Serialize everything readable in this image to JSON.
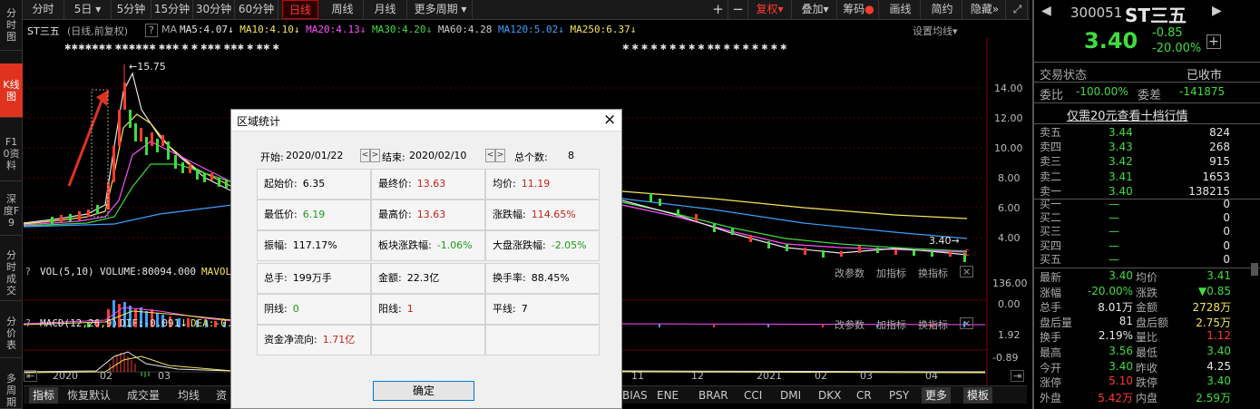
{
  "left_tabs": [
    {
      "label": "分时图",
      "active": false
    },
    {
      "label": "K线图",
      "active": true
    },
    {
      "label": "F10资料",
      "active": false
    },
    {
      "label": "深度F9",
      "active": false
    },
    {
      "label": "分时成交",
      "active": false
    },
    {
      "label": "分价表",
      "active": false
    },
    {
      "label": "多周期",
      "active": false
    }
  ],
  "toolbar": {
    "periods": [
      "分时",
      "5日",
      "5分钟",
      "15分钟",
      "30分钟",
      "60分钟",
      "日线",
      "周线",
      "月线",
      "更多周期"
    ],
    "active_period": "日线",
    "plus": "+",
    "minus": "−",
    "fuquan": "复权",
    "diejia": "叠加",
    "chouma": "筹码",
    "huaxian": "画线",
    "jianyue": "简约",
    "yincang": "隐藏"
  },
  "chart_header": {
    "name": "ST三五",
    "mode": "(日线,前复权)",
    "help": "?",
    "ma_label": "MA",
    "ma": [
      {
        "text": "MA5:4.07",
        "color": "#e6e6e6"
      },
      {
        "text": "MA10:4.10",
        "color": "#f5e55a"
      },
      {
        "text": "MA20:4.13",
        "color": "#ff4fff"
      },
      {
        "text": "MA30:4.20",
        "color": "#3fdc3f"
      },
      {
        "text": "MA60:4.28",
        "color": "#cccccc"
      },
      {
        "text": "MA120:5.02",
        "color": "#3aa0ff"
      },
      {
        "text": "MA250:6.37",
        "color": "#f5e55a"
      }
    ],
    "settings": "设置均线"
  },
  "price_axis": [
    "14.00",
    "12.00",
    "10.00",
    "8.00",
    "6.00",
    "4.00"
  ],
  "annotations": {
    "high": "15.75",
    "last": "3.40",
    "c_mark": "C"
  },
  "volume_panel": {
    "title": "VOL(5,10)",
    "value": "VOLUME:80094.000",
    "mavol": "MAVOL",
    "axis": [
      "136.00",
      "0.00"
    ],
    "actions": [
      "改参数",
      "加指标",
      "换指标"
    ]
  },
  "macd_panel": {
    "title": "MACD(12,26,9)",
    "dif": "DIF:-0.091",
    "dea": "DEA:-0.",
    "axis": [
      "1.92",
      "-0.89"
    ],
    "actions": [
      "改参数",
      "加指标",
      "换指标"
    ]
  },
  "time_axis": [
    "2020",
    "02",
    "03",
    "11",
    "12",
    "2021",
    "02",
    "03",
    "04"
  ],
  "bottom_bar": {
    "tabs_left": [
      "指标",
      "恢复默认",
      "成交量",
      "均线",
      "资"
    ],
    "tabs_right": [
      "BIAS",
      "ENE",
      "BRAR",
      "CCI",
      "DMI",
      "DKX",
      "CR",
      "PSY",
      "更多",
      "模板"
    ]
  },
  "right_panel": {
    "code": "300051",
    "name": "ST三五",
    "price": "3.40",
    "change": "-0.85",
    "change_pct": "-20.00%",
    "status_label": "交易状态",
    "status_value": "已收市",
    "weibi_label": "委比",
    "weibi": "-100.00%",
    "weicha_label": "委差",
    "weicha": "-141875",
    "promo": "仅需20元查看十档行情",
    "asks": [
      {
        "label": "卖五",
        "price": "3.44",
        "vol": "824"
      },
      {
        "label": "卖四",
        "price": "3.43",
        "vol": "268"
      },
      {
        "label": "卖三",
        "price": "3.42",
        "vol": "915"
      },
      {
        "label": "卖二",
        "price": "3.41",
        "vol": "1653"
      },
      {
        "label": "卖一",
        "price": "3.40",
        "vol": "138215"
      }
    ],
    "bids": [
      {
        "label": "买一",
        "price": "—",
        "vol": "0"
      },
      {
        "label": "买二",
        "price": "—",
        "vol": "0"
      },
      {
        "label": "买三",
        "price": "—",
        "vol": "0"
      },
      {
        "label": "买四",
        "price": "—",
        "vol": "0"
      },
      {
        "label": "买五",
        "price": "—",
        "vol": "0"
      }
    ],
    "stats": [
      {
        "l1": "最新",
        "v1": "3.40",
        "c1": "#3fdc3f",
        "l2": "均价",
        "v2": "3.41",
        "c2": "#3fdc3f"
      },
      {
        "l1": "涨幅",
        "v1": "-20.00%",
        "c1": "#3fdc3f",
        "l2": "涨跌",
        "v2": "▼0.85",
        "c2": "#3fdc3f"
      },
      {
        "l1": "总手",
        "v1": "8.01万",
        "c1": "#e6e6e6",
        "l2": "金额",
        "v2": "2728万",
        "c2": "#f5e55a"
      },
      {
        "l1": "盘后量",
        "v1": "81",
        "c1": "#e6e6e6",
        "l2": "盘后额",
        "v2": "2.75万",
        "c2": "#f5e55a"
      },
      {
        "l1": "换手",
        "v1": "2.19%",
        "c1": "#e6e6e6",
        "l2": "量比",
        "v2": "1.12",
        "c2": "#ff3b2f"
      },
      {
        "l1": "最高",
        "v1": "3.56",
        "c1": "#3fdc3f",
        "l2": "最低",
        "v2": "3.40",
        "c2": "#3fdc3f"
      },
      {
        "l1": "今开",
        "v1": "3.40",
        "c1": "#3fdc3f",
        "l2": "昨收",
        "v2": "4.25",
        "c2": "#e6e6e6"
      },
      {
        "l1": "涨停",
        "v1": "5.10",
        "c1": "#ff3b2f",
        "l2": "跌停",
        "v2": "3.40",
        "c2": "#3fdc3f"
      },
      {
        "l1": "外盘",
        "v1": "5.42万",
        "c1": "#ff3b2f",
        "l2": "内盘",
        "v2": "2.59万",
        "c2": "#3fdc3f"
      }
    ]
  },
  "dialog": {
    "title": "区域统计",
    "start_label": "开始:",
    "start": "2020/01/22",
    "end_label": "结束:",
    "end": "2020/02/10",
    "count_label": "总个数:",
    "count": "8",
    "cells": [
      {
        "label": "起始价:",
        "value": "6.35",
        "color": "#000"
      },
      {
        "label": "最终价:",
        "value": "13.63",
        "color": "#c8201a"
      },
      {
        "label": "均价:",
        "value": "11.19",
        "color": "#c8201a"
      },
      {
        "label": "最低价:",
        "value": "6.19",
        "color": "#1a9a1a"
      },
      {
        "label": "最高价:",
        "value": "13.63",
        "color": "#c8201a"
      },
      {
        "label": "涨跌幅:",
        "value": "114.65%",
        "color": "#c8201a"
      },
      {
        "label": "振幅:",
        "value": "117.17%",
        "color": "#000"
      },
      {
        "label": "板块涨跌幅:",
        "value": "-1.06%",
        "color": "#1a9a1a"
      },
      {
        "label": "大盘涨跌幅:",
        "value": "-2.05%",
        "color": "#1a9a1a"
      },
      {
        "label": "总手:",
        "value": "199万手",
        "color": "#000"
      },
      {
        "label": "金额:",
        "value": "22.3亿",
        "color": "#000"
      },
      {
        "label": "换手率:",
        "value": "88.45%",
        "color": "#000"
      },
      {
        "label": "阴线:",
        "value": "0",
        "color": "#1a9a1a"
      },
      {
        "label": "阳线:",
        "value": "1",
        "color": "#c8201a"
      },
      {
        "label": "平线:",
        "value": "7",
        "color": "#000"
      },
      {
        "label": "资金净流向:",
        "value": "1.71亿",
        "color": "#c8201a"
      }
    ],
    "ok": "确定"
  }
}
